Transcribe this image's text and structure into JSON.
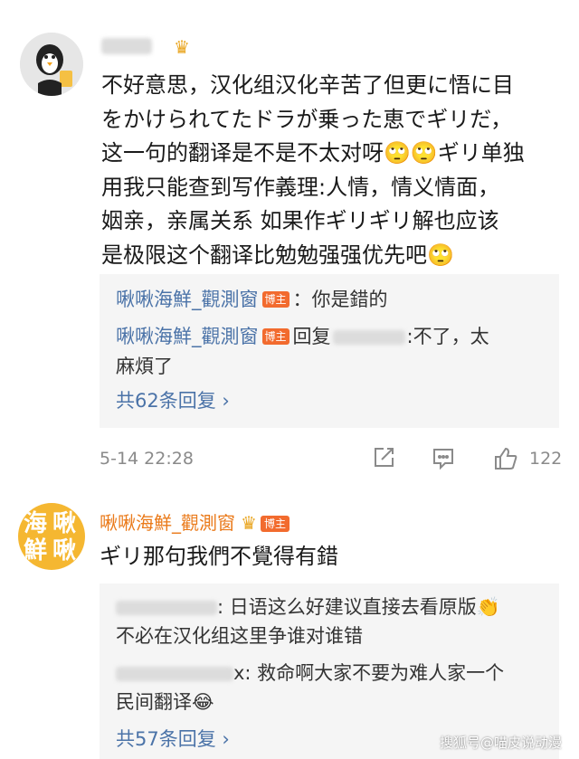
{
  "comment1": {
    "text_lines": [
      "不好意思，汉化组汉化辛苦了但更に悟に目",
      "をかけられてたドラが乗った恵でギリだ，",
      "这一句的翻译是不是不太对呀🙄🙄ギリ单独",
      "用我只能查到写作義理:人情，情义情面，",
      "姻亲，亲属关系 如果作ギリギリ解也应该",
      "是极限这个翻译比勉勉强强优先吧🙄"
    ],
    "replies": [
      {
        "user": "啾啾海鮮_觀測窗",
        "badge": "博主",
        "text": "：你是錯的"
      },
      {
        "user": "啾啾海鮮_觀測窗",
        "badge": "博主",
        "prefix": "回复",
        "text": ":不了，太",
        "cont": "麻煩了"
      }
    ],
    "more": "共62条回复 ›",
    "timestamp": "5-14 22:28",
    "likes": "122"
  },
  "comment2": {
    "user": "啾啾海鮮_觀測窗",
    "user_tag": "博主",
    "text": "ギリ那句我們不覺得有錯",
    "replies": [
      {
        "text": ": 日语这么好建议直接去看原版👏",
        "cont": "不必在汉化组这里争谁对谁错"
      },
      {
        "text": "x: 救命啊大家不要为难人家一个",
        "cont": "民间翻译😂"
      }
    ],
    "more": "共57条回复 ›"
  },
  "watermark": "搜狐号@喵皮说动漫"
}
